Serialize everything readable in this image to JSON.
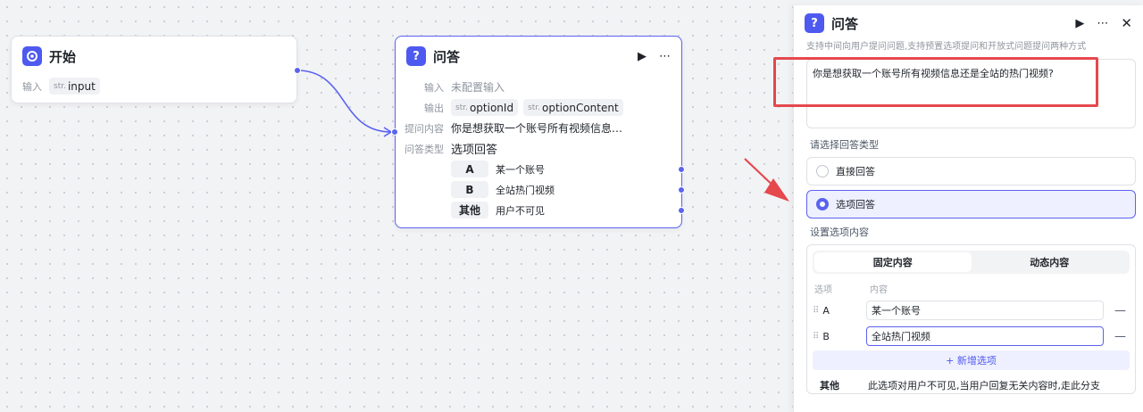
{
  "start_node": {
    "title": "开始",
    "input_label": "输入",
    "input_var": {
      "type": "str.",
      "name": "input"
    }
  },
  "qa_node": {
    "title": "问答",
    "input_label": "输入",
    "input_value": "未配置输入",
    "output_label": "输出",
    "outputs": [
      {
        "type": "str.",
        "name": "optionId"
      },
      {
        "type": "str.",
        "name": "optionContent"
      }
    ],
    "prompt_label": "提问内容",
    "prompt_value": "你是想获取一个账号所有视频信息…",
    "answer_type_label": "问答类型",
    "answer_type_value": "选项回答",
    "options": [
      {
        "key": "A",
        "value": "某一个账号"
      },
      {
        "key": "B",
        "value": "全站热门视频"
      },
      {
        "key": "其他",
        "value": "用户不可见"
      }
    ]
  },
  "panel": {
    "title": "问答",
    "subtitle": "支持中间向用户提问问题,支持预置选项提问和开放式问题提问两种方式",
    "prompt": "你是想获取一个账号所有视频信息还是全站的热门视频?",
    "answer_type_section": "请选择回答类型",
    "answer_types": [
      {
        "label": "直接回答",
        "selected": false
      },
      {
        "label": "选项回答",
        "selected": true
      }
    ],
    "options_section": "设置选项内容",
    "tabs": [
      {
        "label": "固定内容",
        "active": true
      },
      {
        "label": "动态内容",
        "active": false
      }
    ],
    "col_option": "选项",
    "col_content": "内容",
    "option_rows": [
      {
        "key": "A",
        "value": "某一个账号"
      },
      {
        "key": "B",
        "value": "全站热门视频"
      }
    ],
    "add_option": "+ 新增选项",
    "other_key": "其他",
    "other_desc": "此选项对用户不可见,当用户回复无关内容时,走此分支"
  },
  "colors": {
    "accent": "#5a63f0",
    "highlight": "#e5484d"
  }
}
